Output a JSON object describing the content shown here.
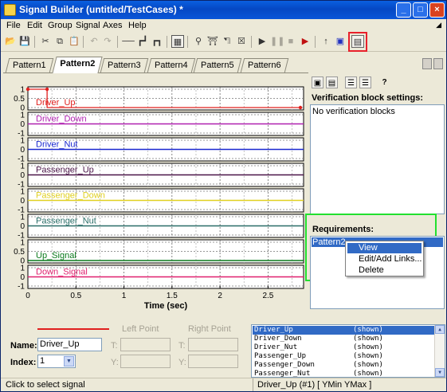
{
  "window": {
    "title": "Signal Builder (untitled/TestCases) *",
    "controls": {
      "minimize": "_",
      "maximize": "□",
      "close": "×"
    }
  },
  "menu": [
    "File",
    "Edit",
    "Group",
    "Signal",
    "Axes",
    "Help"
  ],
  "toolbar": {
    "icons": [
      "open-icon",
      "save-icon",
      "cut-icon",
      "copy-icon",
      "paste-icon",
      "undo-icon",
      "redo-icon",
      "constant-signal-icon",
      "step-signal-icon",
      "pulse-signal-icon",
      "grid-icon",
      "zoom-icon",
      "zoom-x-icon",
      "zoom-y-icon",
      "zoom-out-icon",
      "play-icon",
      "pause-icon",
      "stop-icon",
      "run-all-icon",
      "up-arrow-icon",
      "export-icon",
      "verification-panel-icon"
    ],
    "highlighted": "verification-panel-icon",
    "highlight_color": "#e8202b"
  },
  "tabs": [
    {
      "label": "Pattern1",
      "active": false
    },
    {
      "label": "Pattern2",
      "active": true
    },
    {
      "label": "Pattern3",
      "active": false
    },
    {
      "label": "Pattern4",
      "active": false
    },
    {
      "label": "Pattern5",
      "active": false
    },
    {
      "label": "Pattern6",
      "active": false
    }
  ],
  "plot": {
    "xlabel": "Time (sec)",
    "xticks": [
      "0",
      "0.5",
      "1",
      "1.5",
      "2",
      "2.5"
    ],
    "signals": [
      {
        "name": "Driver_Up",
        "color": "#e0201e",
        "yticks": [
          "1",
          "0.5",
          "0"
        ],
        "level": 0,
        "pulse": true,
        "selected": true
      },
      {
        "name": "Driver_Down",
        "color": "#b020b0",
        "yticks": [
          "1",
          "0",
          "-1"
        ],
        "level": 0
      },
      {
        "name": "Driver_Nut",
        "color": "#1a28d0",
        "yticks": [
          "1",
          "0",
          "-1"
        ],
        "level": 0
      },
      {
        "name": "Passenger_Up",
        "color": "#4a1448",
        "yticks": [
          "1",
          "0",
          "-1"
        ],
        "level": 0
      },
      {
        "name": "Passenger_Down",
        "color": "#e0d020",
        "yticks": [
          "1",
          "0",
          "-1"
        ],
        "level": 0
      },
      {
        "name": "Passenger_Nut",
        "color": "#2a6e68",
        "yticks": [
          "1",
          "0",
          "-1"
        ],
        "level": 0
      },
      {
        "name": "Up_Signal",
        "color": "#0a7a1c",
        "yticks": [
          "1",
          "0.5",
          "0"
        ],
        "level": 0
      },
      {
        "name": "Down_Signal",
        "color": "#e0206e",
        "yticks": [
          "1",
          "0",
          "-1"
        ],
        "level": 0
      }
    ]
  },
  "verification": {
    "title": "Verification block settings:",
    "content": "No verification blocks",
    "tool_icons": [
      "verification-block-icon",
      "document-icon",
      "tree-view-icon",
      "list-view-icon",
      "help-icon"
    ]
  },
  "requirements": {
    "title": "Requirements:",
    "selected_item": "Pattern2",
    "highlight_color": "#22e02f"
  },
  "context_menu": {
    "items": [
      "View",
      "Edit/Add Links...",
      "Delete"
    ],
    "hovered": "View"
  },
  "signal_properties": {
    "name_label": "Name:",
    "name_value": "Driver_Up",
    "index_label": "Index:",
    "index_value": "1",
    "left_point_label": "Left Point",
    "right_point_label": "Right Point",
    "t_label": "T:",
    "y_label": "Y:"
  },
  "signal_list": [
    {
      "name": "Driver_Up",
      "status": "(shown)",
      "selected": true
    },
    {
      "name": "Driver_Down",
      "status": "(shown)"
    },
    {
      "name": "Driver_Nut",
      "status": "(shown)"
    },
    {
      "name": "Passenger_Up",
      "status": "(shown)"
    },
    {
      "name": "Passenger_Down",
      "status": "(shown)"
    },
    {
      "name": "Passenger_Nut",
      "status": "(shown)"
    }
  ],
  "status": {
    "left": "Click to select signal",
    "right": "Driver_Up (#1)  [ YMin YMax ]"
  }
}
